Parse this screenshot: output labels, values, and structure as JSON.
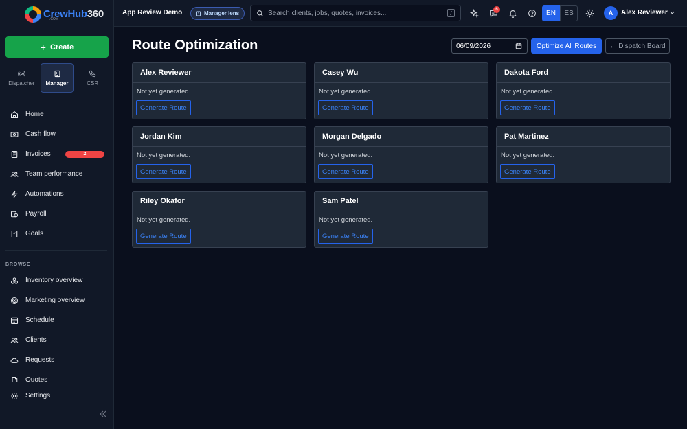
{
  "brand": {
    "name": "CrewHub",
    "number": "360",
    "sub": ".COM"
  },
  "sidebar": {
    "create_label": "Create",
    "lenses": [
      {
        "label": "Dispatcher",
        "icon": "broadcast-icon"
      },
      {
        "label": "Manager",
        "icon": "building-icon"
      },
      {
        "label": "CSR",
        "icon": "phone-icon"
      }
    ],
    "items": [
      {
        "label": "Home",
        "icon": "home-icon"
      },
      {
        "label": "Cash flow",
        "icon": "cash-icon"
      },
      {
        "label": "Invoices",
        "icon": "invoice-icon",
        "badge": "2"
      },
      {
        "label": "Team performance",
        "icon": "team-icon"
      },
      {
        "label": "Automations",
        "icon": "bolt-icon"
      },
      {
        "label": "Payroll",
        "icon": "payroll-icon"
      },
      {
        "label": "Goals",
        "icon": "goal-icon"
      }
    ],
    "browse_label": "BROWSE",
    "browse_items": [
      {
        "label": "Inventory overview",
        "icon": "inventory-icon"
      },
      {
        "label": "Marketing overview",
        "icon": "target-icon"
      },
      {
        "label": "Schedule",
        "icon": "calendar-icon"
      },
      {
        "label": "Clients",
        "icon": "clients-icon"
      },
      {
        "label": "Requests",
        "icon": "cloud-icon"
      },
      {
        "label": "Quotes",
        "icon": "quote-icon"
      }
    ],
    "settings_label": "Settings"
  },
  "topbar": {
    "app_title": "App Review Demo",
    "lens_label": "Manager lens",
    "search_placeholder": "Search clients, jobs, quotes, invoices...",
    "search_shortcut": "/",
    "notification_count": "6",
    "lang_en": "EN",
    "lang_es": "ES",
    "user_initial": "A",
    "user_name": "Alex Reviewer"
  },
  "main": {
    "title": "Route Optimization",
    "date": "06/09/2026",
    "optimize_label": "Optimize All Routes",
    "dispatch_label": "← Dispatch Board",
    "cards": [
      {
        "name": "Alex Reviewer",
        "status": "Not yet generated.",
        "button": "Generate Route"
      },
      {
        "name": "Casey Wu",
        "status": "Not yet generated.",
        "button": "Generate Route"
      },
      {
        "name": "Dakota Ford",
        "status": "Not yet generated.",
        "button": "Generate Route"
      },
      {
        "name": "Jordan Kim",
        "status": "Not yet generated.",
        "button": "Generate Route"
      },
      {
        "name": "Morgan Delgado",
        "status": "Not yet generated.",
        "button": "Generate Route"
      },
      {
        "name": "Pat Martinez",
        "status": "Not yet generated.",
        "button": "Generate Route"
      },
      {
        "name": "Riley Okafor",
        "status": "Not yet generated.",
        "button": "Generate Route"
      },
      {
        "name": "Sam Patel",
        "status": "Not yet generated.",
        "button": "Generate Route"
      }
    ]
  },
  "colors": {
    "accent": "#2563eb",
    "create": "#16a34a",
    "badge": "#ef4444",
    "background": "#0a0f1d"
  }
}
